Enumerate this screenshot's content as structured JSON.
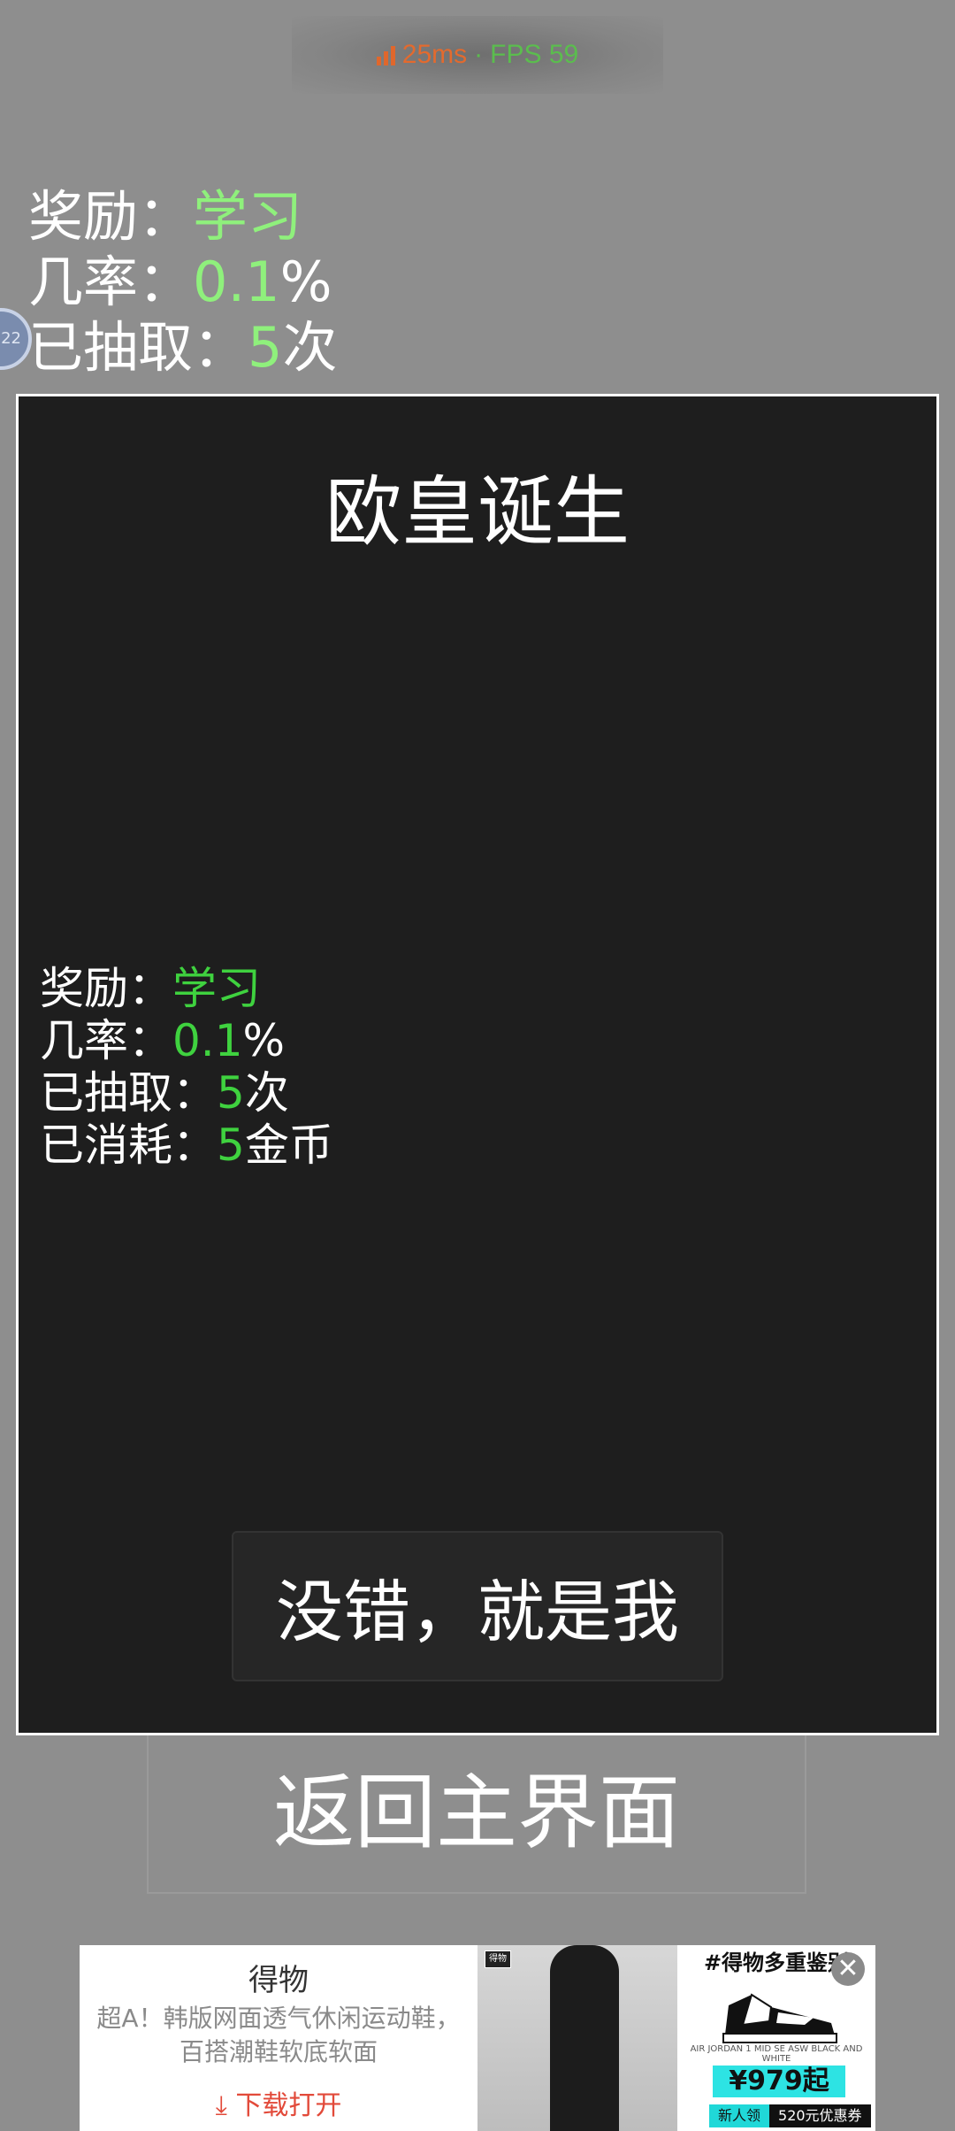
{
  "status": {
    "latency": "25ms",
    "separator": "·",
    "fps": "FPS 59",
    "latency_color": "#e36a2e",
    "fps_color": "#5bbd4e"
  },
  "background_stats": {
    "reward_label": "奖励：",
    "reward_value": "学习",
    "chance_label": "几率：",
    "chance_value": "0.1",
    "chance_unit": "%",
    "draws_label": "已抽取：",
    "draws_value": "5",
    "draws_unit": "次"
  },
  "floating_ball": {
    "text": "22"
  },
  "dialog": {
    "title": "欧皇诞生",
    "stats": {
      "reward_label": "奖励：",
      "reward_value": "学习",
      "chance_label": "几率：",
      "chance_value": "0.1",
      "chance_unit": "%",
      "draws_label": "已抽取：",
      "draws_value": "5",
      "draws_unit": "次",
      "spent_label": "已消耗：",
      "spent_value": "5",
      "spent_unit": "金币"
    },
    "confirm_label": "没错，就是我"
  },
  "back_button_label": "返回主界面",
  "ad": {
    "brand": "得物",
    "desc_line1": "超A！韩版网面透气休闲运动鞋，",
    "desc_line2": "百搭潮鞋软底软面",
    "download": "下载打开",
    "photo_logo": "得物",
    "product_tag": "#得物多重鉴别",
    "product_small": "AIR JORDAN 1 MID SE ASW BLACK AND WHITE",
    "price": "¥979起",
    "badge_new": "新人领",
    "badge_coupon": "520元优惠券",
    "close": "✕"
  },
  "colors": {
    "background": "#8e8e8e",
    "dialog_bg": "#1e1e1e",
    "highlight_green": "#3fd23f",
    "background_green": "#8ff07c"
  }
}
